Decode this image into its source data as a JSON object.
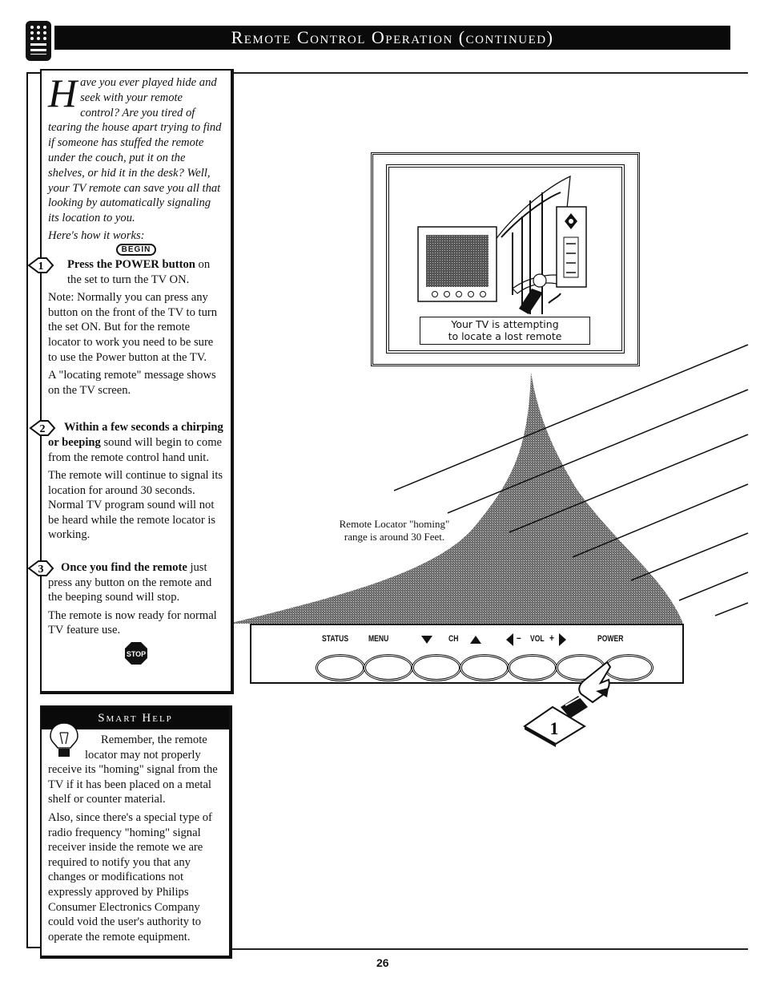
{
  "header": {
    "title": "Remote Control Operation (continued)",
    "icon": "remote-control-icon"
  },
  "intro": {
    "dropcap": "H",
    "text": "ave you ever played hide and seek with your remote control? Are you tired of tearing the house apart trying to find if someone has stuffed the remote under the couch, put it on the shelves, or hid it in the desk? Well, your TV remote can save you all that looking by automatically signaling its location to you.",
    "how_it_works": "Here's how it works:",
    "begin_badge": "BEGIN"
  },
  "steps": [
    {
      "number": "1",
      "bold": "Press the POWER button",
      "rest": " on the set to turn the TV ON.",
      "notes": [
        "Note: Normally you can press any button on the front of the TV to turn the set ON. But for the remote locator to work you need to be sure to use the Power button at the TV.",
        "A \"locating remote\" message shows on the TV screen."
      ]
    },
    {
      "number": "2",
      "bold": "Within a few seconds a chirping or beeping",
      "rest": " sound will begin to come from the remote control hand unit.",
      "notes": [
        "The remote will continue to signal its location for around 30 seconds. Normal TV program sound will not be heard while the remote locator is working."
      ]
    },
    {
      "number": "3",
      "bold": "Once you find the remote",
      "rest": " just press any button on the remote and the beeping sound will stop.",
      "notes": [
        "The remote is now ready for normal TV feature use."
      ]
    }
  ],
  "stop_badge": "STOP",
  "smart_help": {
    "title": "Smart Help",
    "paragraphs": [
      "Remember, the remote locator may not properly receive its \"homing\" signal from the TV if it has been placed on a metal shelf or counter material.",
      "Also, since there's a special type of radio frequency \"homing\" signal receiver inside the remote we are required to notify you that any changes or modifications not expressly approved by Philips Consumer Electronics Company could void the user's authority to operate the remote equipment."
    ]
  },
  "illustration": {
    "tv_screen_message": "Your TV is attempting to locate a lost remote",
    "tv_message_line1": "Your TV is attempting",
    "tv_message_line2": "to locate a lost remote",
    "range_label_line1": "Remote Locator \"homing\"",
    "range_label_line2": "range is around 30 Feet."
  },
  "control_panel": {
    "labels": {
      "status": "STATUS",
      "menu": "MENU",
      "ch": "CH",
      "vol_minus": "–",
      "vol": "VOL",
      "vol_plus": "+",
      "power": "POWER"
    },
    "buttons": [
      "status",
      "menu",
      "ch-down",
      "ch-up",
      "vol-down",
      "vol-up",
      "power"
    ],
    "pressed_button": "power",
    "step_marker": "1"
  },
  "footer": {
    "page_number": "26"
  }
}
